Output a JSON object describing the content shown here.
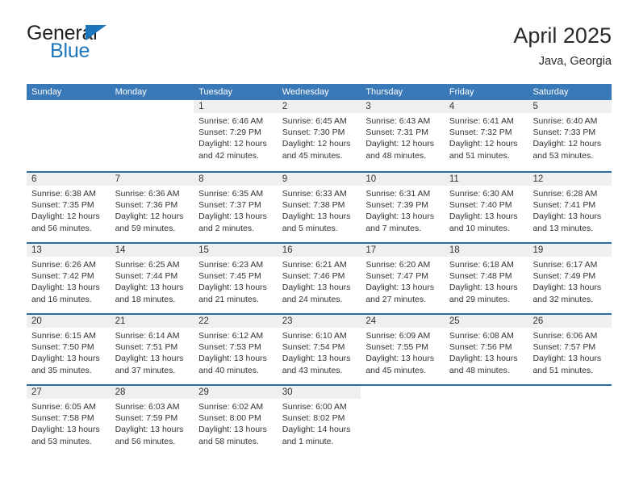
{
  "brand": {
    "name_part1": "General",
    "name_part2": "Blue",
    "accent_color": "#1b75bb"
  },
  "header": {
    "title": "April 2025",
    "subtitle": "Java, Georgia"
  },
  "theme": {
    "header_blue": "#3a79b8",
    "separator_blue": "#2e6da4",
    "day_band_gray": "#efefef"
  },
  "weekdays": [
    "Sunday",
    "Monday",
    "Tuesday",
    "Wednesday",
    "Thursday",
    "Friday",
    "Saturday"
  ],
  "labels": {
    "sunrise_prefix": "Sunrise:",
    "sunset_prefix": "Sunset:",
    "daylight_prefix": "Daylight:"
  },
  "weeks": [
    [
      {
        "date": "",
        "empty": true
      },
      {
        "date": "",
        "empty": true
      },
      {
        "date": "1",
        "sunrise": "Sunrise: 6:46 AM",
        "sunset": "Sunset: 7:29 PM",
        "daylight1": "Daylight: 12 hours",
        "daylight2": "and 42 minutes."
      },
      {
        "date": "2",
        "sunrise": "Sunrise: 6:45 AM",
        "sunset": "Sunset: 7:30 PM",
        "daylight1": "Daylight: 12 hours",
        "daylight2": "and 45 minutes."
      },
      {
        "date": "3",
        "sunrise": "Sunrise: 6:43 AM",
        "sunset": "Sunset: 7:31 PM",
        "daylight1": "Daylight: 12 hours",
        "daylight2": "and 48 minutes."
      },
      {
        "date": "4",
        "sunrise": "Sunrise: 6:41 AM",
        "sunset": "Sunset: 7:32 PM",
        "daylight1": "Daylight: 12 hours",
        "daylight2": "and 51 minutes."
      },
      {
        "date": "5",
        "sunrise": "Sunrise: 6:40 AM",
        "sunset": "Sunset: 7:33 PM",
        "daylight1": "Daylight: 12 hours",
        "daylight2": "and 53 minutes."
      }
    ],
    [
      {
        "date": "6",
        "sunrise": "Sunrise: 6:38 AM",
        "sunset": "Sunset: 7:35 PM",
        "daylight1": "Daylight: 12 hours",
        "daylight2": "and 56 minutes."
      },
      {
        "date": "7",
        "sunrise": "Sunrise: 6:36 AM",
        "sunset": "Sunset: 7:36 PM",
        "daylight1": "Daylight: 12 hours",
        "daylight2": "and 59 minutes."
      },
      {
        "date": "8",
        "sunrise": "Sunrise: 6:35 AM",
        "sunset": "Sunset: 7:37 PM",
        "daylight1": "Daylight: 13 hours",
        "daylight2": "and 2 minutes."
      },
      {
        "date": "9",
        "sunrise": "Sunrise: 6:33 AM",
        "sunset": "Sunset: 7:38 PM",
        "daylight1": "Daylight: 13 hours",
        "daylight2": "and 5 minutes."
      },
      {
        "date": "10",
        "sunrise": "Sunrise: 6:31 AM",
        "sunset": "Sunset: 7:39 PM",
        "daylight1": "Daylight: 13 hours",
        "daylight2": "and 7 minutes."
      },
      {
        "date": "11",
        "sunrise": "Sunrise: 6:30 AM",
        "sunset": "Sunset: 7:40 PM",
        "daylight1": "Daylight: 13 hours",
        "daylight2": "and 10 minutes."
      },
      {
        "date": "12",
        "sunrise": "Sunrise: 6:28 AM",
        "sunset": "Sunset: 7:41 PM",
        "daylight1": "Daylight: 13 hours",
        "daylight2": "and 13 minutes."
      }
    ],
    [
      {
        "date": "13",
        "sunrise": "Sunrise: 6:26 AM",
        "sunset": "Sunset: 7:42 PM",
        "daylight1": "Daylight: 13 hours",
        "daylight2": "and 16 minutes."
      },
      {
        "date": "14",
        "sunrise": "Sunrise: 6:25 AM",
        "sunset": "Sunset: 7:44 PM",
        "daylight1": "Daylight: 13 hours",
        "daylight2": "and 18 minutes."
      },
      {
        "date": "15",
        "sunrise": "Sunrise: 6:23 AM",
        "sunset": "Sunset: 7:45 PM",
        "daylight1": "Daylight: 13 hours",
        "daylight2": "and 21 minutes."
      },
      {
        "date": "16",
        "sunrise": "Sunrise: 6:21 AM",
        "sunset": "Sunset: 7:46 PM",
        "daylight1": "Daylight: 13 hours",
        "daylight2": "and 24 minutes."
      },
      {
        "date": "17",
        "sunrise": "Sunrise: 6:20 AM",
        "sunset": "Sunset: 7:47 PM",
        "daylight1": "Daylight: 13 hours",
        "daylight2": "and 27 minutes."
      },
      {
        "date": "18",
        "sunrise": "Sunrise: 6:18 AM",
        "sunset": "Sunset: 7:48 PM",
        "daylight1": "Daylight: 13 hours",
        "daylight2": "and 29 minutes."
      },
      {
        "date": "19",
        "sunrise": "Sunrise: 6:17 AM",
        "sunset": "Sunset: 7:49 PM",
        "daylight1": "Daylight: 13 hours",
        "daylight2": "and 32 minutes."
      }
    ],
    [
      {
        "date": "20",
        "sunrise": "Sunrise: 6:15 AM",
        "sunset": "Sunset: 7:50 PM",
        "daylight1": "Daylight: 13 hours",
        "daylight2": "and 35 minutes."
      },
      {
        "date": "21",
        "sunrise": "Sunrise: 6:14 AM",
        "sunset": "Sunset: 7:51 PM",
        "daylight1": "Daylight: 13 hours",
        "daylight2": "and 37 minutes."
      },
      {
        "date": "22",
        "sunrise": "Sunrise: 6:12 AM",
        "sunset": "Sunset: 7:53 PM",
        "daylight1": "Daylight: 13 hours",
        "daylight2": "and 40 minutes."
      },
      {
        "date": "23",
        "sunrise": "Sunrise: 6:10 AM",
        "sunset": "Sunset: 7:54 PM",
        "daylight1": "Daylight: 13 hours",
        "daylight2": "and 43 minutes."
      },
      {
        "date": "24",
        "sunrise": "Sunrise: 6:09 AM",
        "sunset": "Sunset: 7:55 PM",
        "daylight1": "Daylight: 13 hours",
        "daylight2": "and 45 minutes."
      },
      {
        "date": "25",
        "sunrise": "Sunrise: 6:08 AM",
        "sunset": "Sunset: 7:56 PM",
        "daylight1": "Daylight: 13 hours",
        "daylight2": "and 48 minutes."
      },
      {
        "date": "26",
        "sunrise": "Sunrise: 6:06 AM",
        "sunset": "Sunset: 7:57 PM",
        "daylight1": "Daylight: 13 hours",
        "daylight2": "and 51 minutes."
      }
    ],
    [
      {
        "date": "27",
        "sunrise": "Sunrise: 6:05 AM",
        "sunset": "Sunset: 7:58 PM",
        "daylight1": "Daylight: 13 hours",
        "daylight2": "and 53 minutes."
      },
      {
        "date": "28",
        "sunrise": "Sunrise: 6:03 AM",
        "sunset": "Sunset: 7:59 PM",
        "daylight1": "Daylight: 13 hours",
        "daylight2": "and 56 minutes."
      },
      {
        "date": "29",
        "sunrise": "Sunrise: 6:02 AM",
        "sunset": "Sunset: 8:00 PM",
        "daylight1": "Daylight: 13 hours",
        "daylight2": "and 58 minutes."
      },
      {
        "date": "30",
        "sunrise": "Sunrise: 6:00 AM",
        "sunset": "Sunset: 8:02 PM",
        "daylight1": "Daylight: 14 hours",
        "daylight2": "and 1 minute."
      },
      {
        "date": "",
        "empty": true
      },
      {
        "date": "",
        "empty": true
      },
      {
        "date": "",
        "empty": true
      }
    ]
  ]
}
